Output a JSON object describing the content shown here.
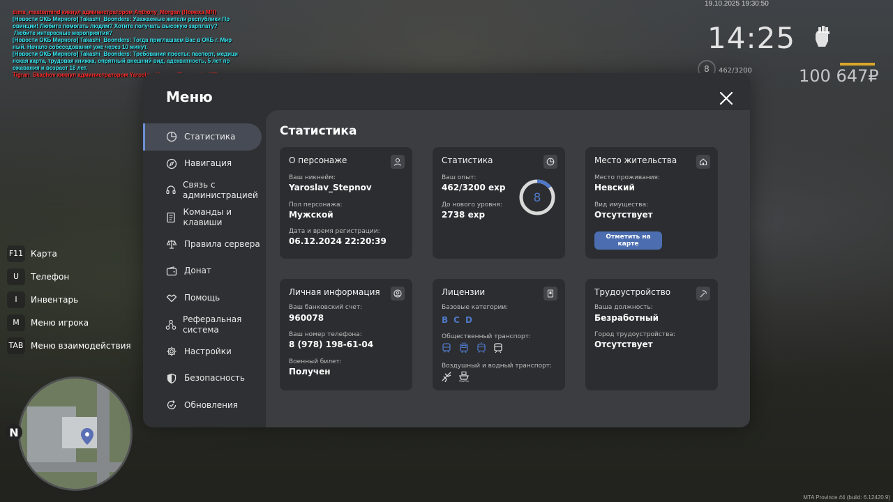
{
  "chat": [
    {
      "text": "dima_mastermind кикнул администратором Anthony_Morgan (Помеха МП)",
      "color": "red"
    },
    {
      "text": "[Новости ОКБ Мирного] Takashi_Boonders: Уважаемые жители республики Пр овинции! Любите помогать людям? Хотите получать высокую зарплату?",
      "color": "cyan"
    },
    {
      "text": " Любите интересные мероприятия?",
      "color": "cyan"
    },
    {
      "text": "[Новости ОКБ Мирного] Takashi_Boonders: Тогда приглашаем Вас в ОКБ г. Мир ный. Начало собеседования уже через 10 минут.",
      "color": "cyan"
    },
    {
      "text": "[Новости ОКБ Мирного] Takashi_Boonders: Требования просты: паспорт, медици нская карта, трудовая книжка, опрятный внешний вид, адекватность, 5 лет пр ожавания и возраст 18 лет.",
      "color": "cyan"
    },
    {
      "text": "Tigran_Skachov кикнул администратором Yaroslav_Mayers (Помеха by NT)",
      "color": "red"
    }
  ],
  "hud": {
    "datetime": "19.10.2025 19:30:50",
    "time": "14:25",
    "level": "8",
    "exp": "462/3200",
    "money": "100 647₽"
  },
  "build": "MTA Province #4 (build: 6.12420.9)",
  "hotkeys": [
    {
      "key": "F11",
      "label": "Карта"
    },
    {
      "key": "U",
      "label": "Телефон"
    },
    {
      "key": "I",
      "label": "Инвентарь"
    },
    {
      "key": "M",
      "label": "Меню игрока"
    },
    {
      "key": "TAB",
      "label": "Меню взаимодействия"
    }
  ],
  "minimap": {
    "north": "N"
  },
  "menu": {
    "title": "Меню",
    "nav": [
      {
        "label": "Статистика",
        "icon": "pie-chart-icon"
      },
      {
        "label": "Навигация",
        "icon": "compass-icon"
      },
      {
        "label": "Связь с администрацией",
        "icon": "headset-icon"
      },
      {
        "label": "Команды и клавиши",
        "icon": "document-icon"
      },
      {
        "label": "Правила сервера",
        "icon": "scales-icon"
      },
      {
        "label": "Донат",
        "icon": "wallet-icon"
      },
      {
        "label": "Помощь",
        "icon": "handshake-icon"
      },
      {
        "label": "Реферальная система",
        "icon": "referral-icon"
      },
      {
        "label": "Настройки",
        "icon": "gear-icon"
      },
      {
        "label": "Безопасность",
        "icon": "shield-icon"
      },
      {
        "label": "Обновления",
        "icon": "refresh-check-icon"
      }
    ],
    "page_title": "Статистика",
    "character": {
      "title": "О персонаже",
      "nick_label": "Ваш никнейм:",
      "nick": "Yaroslav_Stepnov",
      "gender_label": "Пол персонажа:",
      "gender": "Мужской",
      "reg_label": "Дата и время регистрации:",
      "reg": "06.12.2024 22:20:39"
    },
    "stats": {
      "title": "Статистика",
      "exp_label": "Ваш опыт:",
      "exp": "462/3200 exp",
      "next_label": "До нового уровня:",
      "next": "2738 exp",
      "level": "8",
      "progress": 0.144,
      "ring_color": "#4f79c8"
    },
    "residence": {
      "title": "Место жительства",
      "place_label": "Место проживания:",
      "place": "Невский",
      "property_label": "Вид имущества:",
      "property": "Отсутствует",
      "map_button": "Отметить на карте"
    },
    "personal": {
      "title": "Личная информация",
      "bank_label": "Ваш банковский счет:",
      "bank": "960078",
      "phone_label": "Ваш номер телефона:",
      "phone": "8 (978) 198-61-04",
      "military_label": "Военный билет:",
      "military": "Получен"
    },
    "licenses": {
      "title": "Лицензии",
      "base_label": "Базовые категории:",
      "categories": [
        "B",
        "C",
        "D"
      ],
      "public_label": "Общественный транспорт:",
      "public_icons": [
        "bus-icon",
        "trolleybus-icon",
        "tram-icon",
        "metro-icon"
      ],
      "air_label": "Воздушный и водный транспорт:",
      "air_icons": [
        "plane-icon",
        "boat-icon"
      ]
    },
    "employment": {
      "title": "Трудоустройство",
      "position_label": "Ваша должность:",
      "position": "Безработный",
      "city_label": "Город трудоустройства:",
      "city": "Отсутствует"
    }
  }
}
